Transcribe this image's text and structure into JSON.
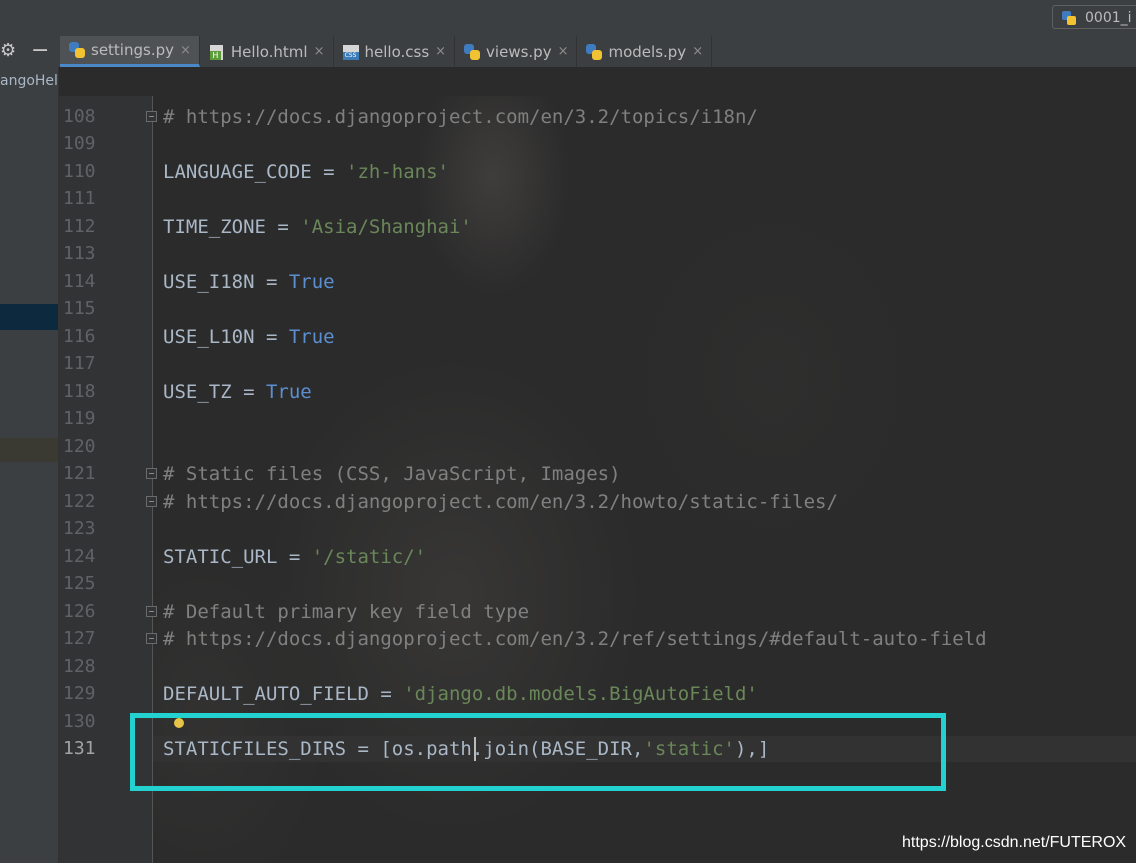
{
  "run_config": {
    "label": "0001_i"
  },
  "project": {
    "label": "angoHel"
  },
  "tabs": [
    {
      "label": "settings.py",
      "icon": "python-file-icon",
      "active": true
    },
    {
      "label": "Hello.html",
      "icon": "html-file-icon",
      "active": false
    },
    {
      "label": "hello.css",
      "icon": "css-file-icon",
      "active": false
    },
    {
      "label": "views.py",
      "icon": "python-file-icon",
      "active": false
    },
    {
      "label": "models.py",
      "icon": "python-file-icon",
      "active": false
    }
  ],
  "tab_close_glyph": "×",
  "line_numbers": [
    "108",
    "109",
    "110",
    "111",
    "112",
    "113",
    "114",
    "115",
    "116",
    "117",
    "118",
    "119",
    "120",
    "121",
    "122",
    "123",
    "124",
    "125",
    "126",
    "127",
    "128",
    "129",
    "130",
    "131"
  ],
  "code": {
    "l108": "# https://docs.djangoproject.com/en/3.2/topics/i18n/",
    "l110_name": "LANGUAGE_CODE = ",
    "l110_value": "'zh-hans'",
    "l112_name": "TIME_ZONE = ",
    "l112_value": "'Asia/Shanghai'",
    "l114_name": "USE_I18N = ",
    "l114_value": "True",
    "l116_name": "USE_L10N = ",
    "l116_value": "True",
    "l118_name": "USE_TZ = ",
    "l118_value": "True",
    "l121": "# Static files (CSS, JavaScript, Images)",
    "l122": "# https://docs.djangoproject.com/en/3.2/howto/static-files/",
    "l124_name": "STATIC_URL = ",
    "l124_value": "'/static/'",
    "l126": "# Default primary key field type",
    "l127": "# https://docs.djangoproject.com/en/3.2/ref/settings/#default-auto-field",
    "l129_name": "DEFAULT_AUTO_FIELD = ",
    "l129_value": "'django.db.models.BigAutoField'",
    "l131_a": "STATICFILES_DIRS = [os.path.join(BASE_DIR,",
    "l131_b": "'static'",
    "l131_c": "),]"
  },
  "watermark": "https://blog.csdn.net/FUTEROX",
  "colors": {
    "highlight_box": "#23d1d1",
    "comment": "#808080",
    "string": "#6a8759",
    "keyword": "#6897bb",
    "active_tab_underline": "#4a88c7"
  }
}
